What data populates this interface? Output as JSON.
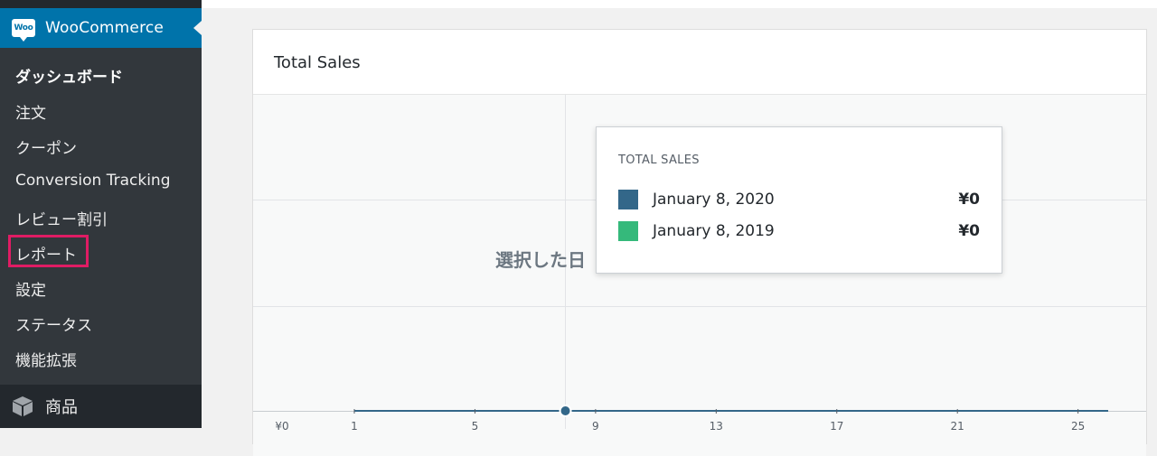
{
  "sidebar": {
    "app_title": "WooCommerce",
    "logo_text": "Woo",
    "items": [
      {
        "label": "ダッシュボード",
        "current": true
      },
      {
        "label": "注文"
      },
      {
        "label": "クーポン"
      },
      {
        "label": "Conversion Tracking"
      },
      {
        "label": "レビュー割引"
      },
      {
        "label": "レポート",
        "highlighted": true
      },
      {
        "label": "設定"
      },
      {
        "label": "ステータス"
      },
      {
        "label": "機能拡張"
      }
    ],
    "products_label": "商品"
  },
  "card": {
    "title": "Total Sales",
    "empty_message": "選択した日"
  },
  "tooltip": {
    "title": "TOTAL SALES",
    "rows": [
      {
        "date": "January 8, 2020",
        "value": "¥0",
        "color": "#336789"
      },
      {
        "date": "January 8, 2019",
        "value": "¥0",
        "color": "#35b97b"
      }
    ]
  },
  "chart_data": {
    "type": "line",
    "y_tick_visible": "¥0",
    "x_ticks": [
      "1",
      "5",
      "9",
      "13",
      "17",
      "21",
      "25"
    ],
    "series": [
      {
        "name": "January 8, 2020",
        "color": "#336789",
        "values": [
          0,
          0,
          0,
          0,
          0,
          0,
          0,
          0,
          0,
          0,
          0,
          0,
          0,
          0,
          0,
          0,
          0,
          0,
          0,
          0,
          0,
          0,
          0,
          0,
          0,
          0
        ]
      },
      {
        "name": "January 8, 2019",
        "color": "#35b97b",
        "values": [
          0,
          0,
          0,
          0,
          0,
          0,
          0,
          0,
          0,
          0,
          0,
          0,
          0,
          0,
          0,
          0,
          0,
          0,
          0,
          0,
          0,
          0,
          0,
          0,
          0,
          0
        ]
      }
    ],
    "x_range": [
      1,
      26
    ],
    "highlight_x": 8
  }
}
